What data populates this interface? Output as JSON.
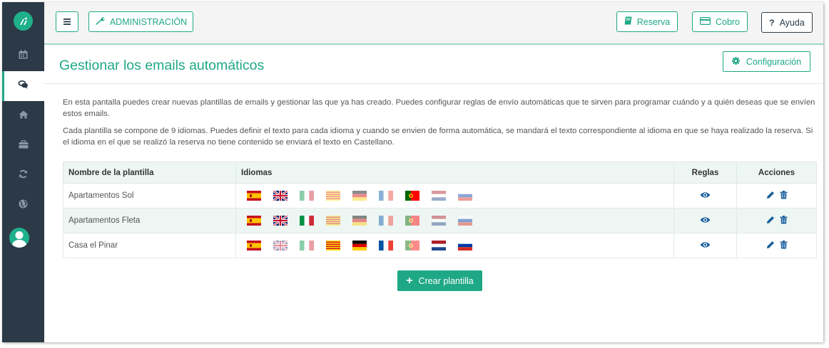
{
  "header": {
    "admin_label": "ADMINISTRACIÓN",
    "reserva_label": "Reserva",
    "cobro_label": "Cobro",
    "ayuda_label": "Ayuda"
  },
  "page": {
    "title": "Gestionar los emails automáticos",
    "config_label": "Configuración",
    "desc1": "En esta pantalla puedes crear nuevas plantillas de emails y gestionar las que ya has creado. Puedes configurar reglas de envío automáticas que te sirven para programar cuándo y a quién deseas que se envíen estos emails.",
    "desc2": "Cada plantilla se compone de 9 idiomas. Puedes definir el texto para cada idioma y cuando se envien de forma automática, se mandará el texto correspondiente al idioma en que se haya realizado la reserva. Si el idioma en el que se realizó la reserva no tiene contenido se enviará el texto en Castellano."
  },
  "table": {
    "headers": [
      "Nombre de la plantilla",
      "Idiomas",
      "Reglas",
      "Acciones"
    ],
    "rows": [
      {
        "name": "Apartamentos Sol",
        "langs": [
          true,
          true,
          false,
          false,
          false,
          false,
          true,
          false,
          false
        ]
      },
      {
        "name": "Apartamentos Fleta",
        "langs": [
          true,
          true,
          true,
          false,
          false,
          false,
          false,
          false,
          false
        ]
      },
      {
        "name": "Casa el Pinar",
        "langs": [
          true,
          false,
          false,
          true,
          true,
          true,
          false,
          true,
          true
        ]
      }
    ]
  },
  "flags": [
    "spain-flag-icon",
    "uk-flag-icon",
    "italy-flag-icon",
    "catalonia-flag-icon",
    "germany-flag-icon",
    "france-flag-icon",
    "portugal-flag-icon",
    "netherlands-flag-icon",
    "russia-flag-icon"
  ],
  "create_label": "Crear plantilla",
  "colors": {
    "accent": "#1fa886",
    "sidebar": "#2c3a47"
  }
}
